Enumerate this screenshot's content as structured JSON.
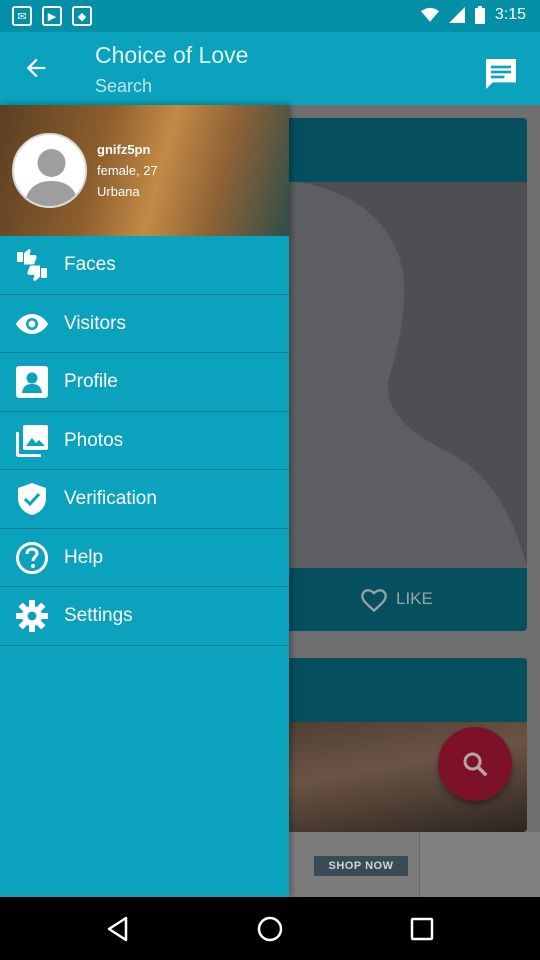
{
  "status_bar": {
    "time": "3:15"
  },
  "app_bar": {
    "title": "Choice of Love",
    "subtitle": "Search"
  },
  "drawer": {
    "username": "gnifz5pn",
    "gender_age": "female, 27",
    "city": "Urbana",
    "items": [
      {
        "label": "Faces",
        "icon": "thumbs-up-down-icon"
      },
      {
        "label": "Visitors",
        "icon": "eye-icon"
      },
      {
        "label": "Profile",
        "icon": "contact-card-icon"
      },
      {
        "label": "Photos",
        "icon": "photo-library-icon"
      },
      {
        "label": "Verification",
        "icon": "verified-shield-icon"
      },
      {
        "label": "Help",
        "icon": "help-circle-icon"
      },
      {
        "label": "Settings",
        "icon": "gear-icon"
      }
    ]
  },
  "card": {
    "like_label": "LIKE"
  },
  "ad": {
    "button_label": "SHOP NOW"
  },
  "colors": {
    "primary": "#0aa2bd",
    "status": "#0390a7",
    "fab": "#7d1127"
  }
}
